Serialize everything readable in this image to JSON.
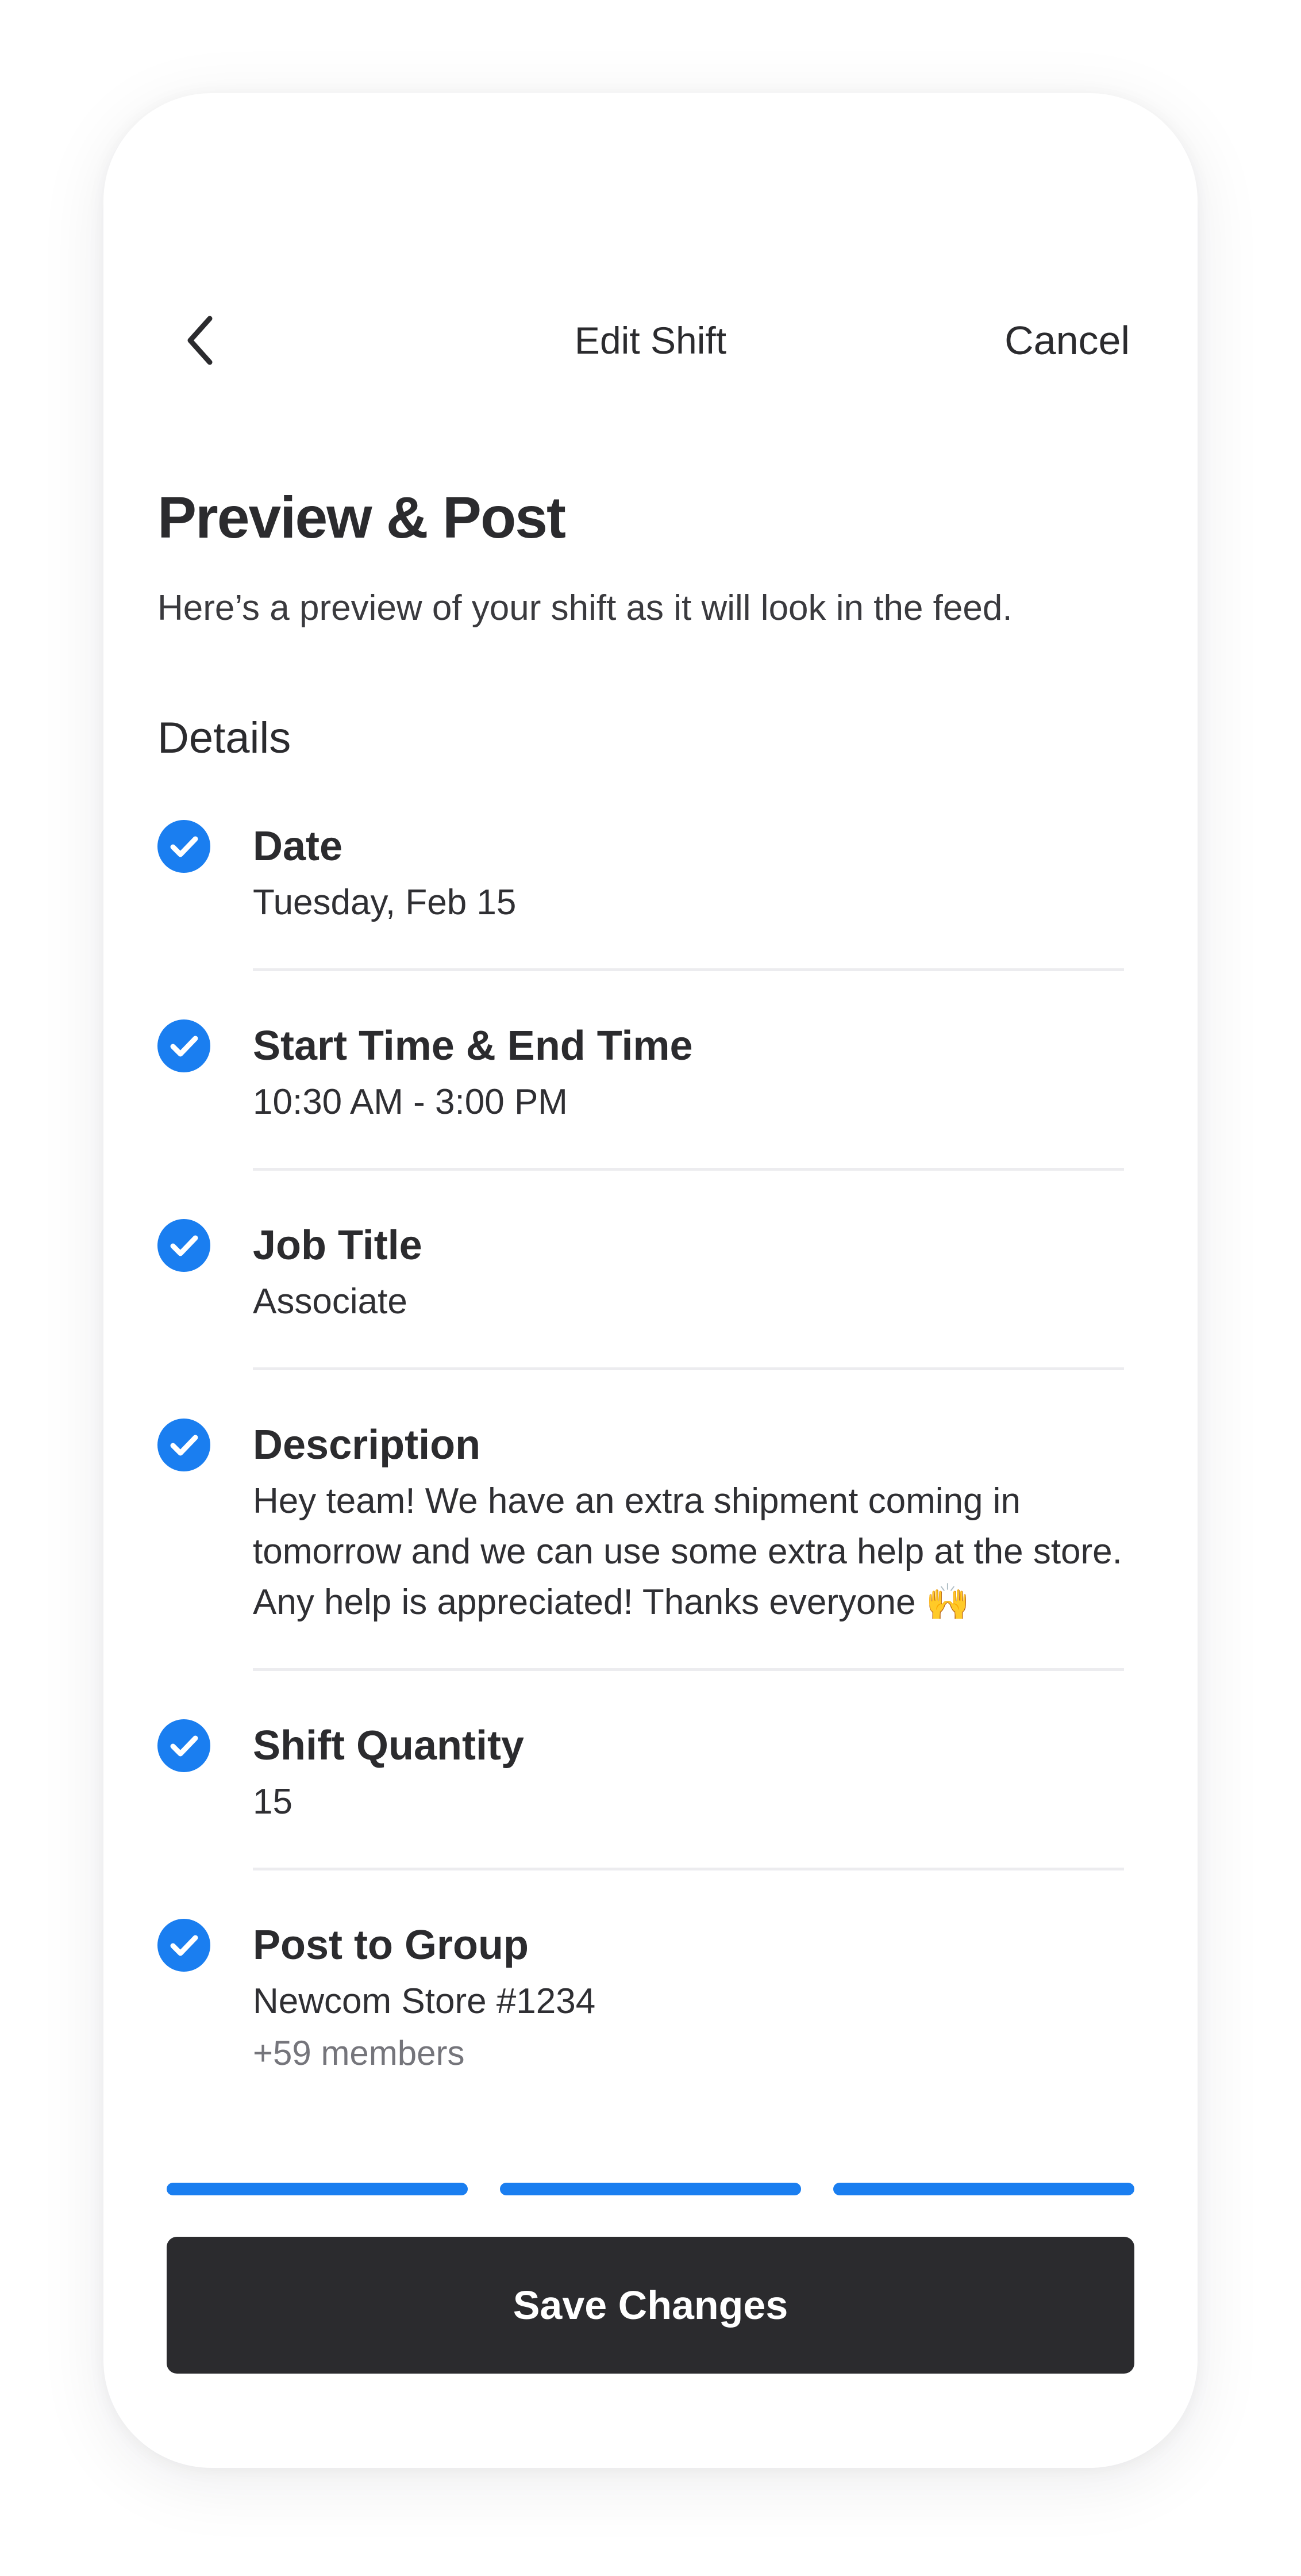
{
  "header": {
    "back_icon": "chevron-left-icon",
    "title": "Edit Shift",
    "cancel_label": "Cancel"
  },
  "page": {
    "title": "Preview & Post",
    "subtitle": "Here’s a preview of your shift as it will look in the feed.",
    "section_title": "Details"
  },
  "details": {
    "date": {
      "label": "Date",
      "value": "Tuesday, Feb 15"
    },
    "time": {
      "label": "Start Time & End Time",
      "value": "10:30 AM - 3:00 PM"
    },
    "job": {
      "label": "Job Title",
      "value": "Associate"
    },
    "description": {
      "label": "Description",
      "value": "Hey team! We have an extra shipment coming in tomorrow and we can use some extra help at the store. Any help is appreciated! Thanks everyone 🙌"
    },
    "quantity": {
      "label": "Shift Quantity",
      "value": "15"
    },
    "group": {
      "label": "Post to Group",
      "value": "Newcom Store #1234",
      "members": "+59 members"
    }
  },
  "progress": {
    "total_steps": 3,
    "completed_steps": 3
  },
  "actions": {
    "save_label": "Save Changes"
  },
  "colors": {
    "accent": "#1a7ef0",
    "button_dark": "#2b2b2e",
    "text_primary": "#2b2b2e",
    "text_muted": "#75757b",
    "divider": "#ececef"
  }
}
